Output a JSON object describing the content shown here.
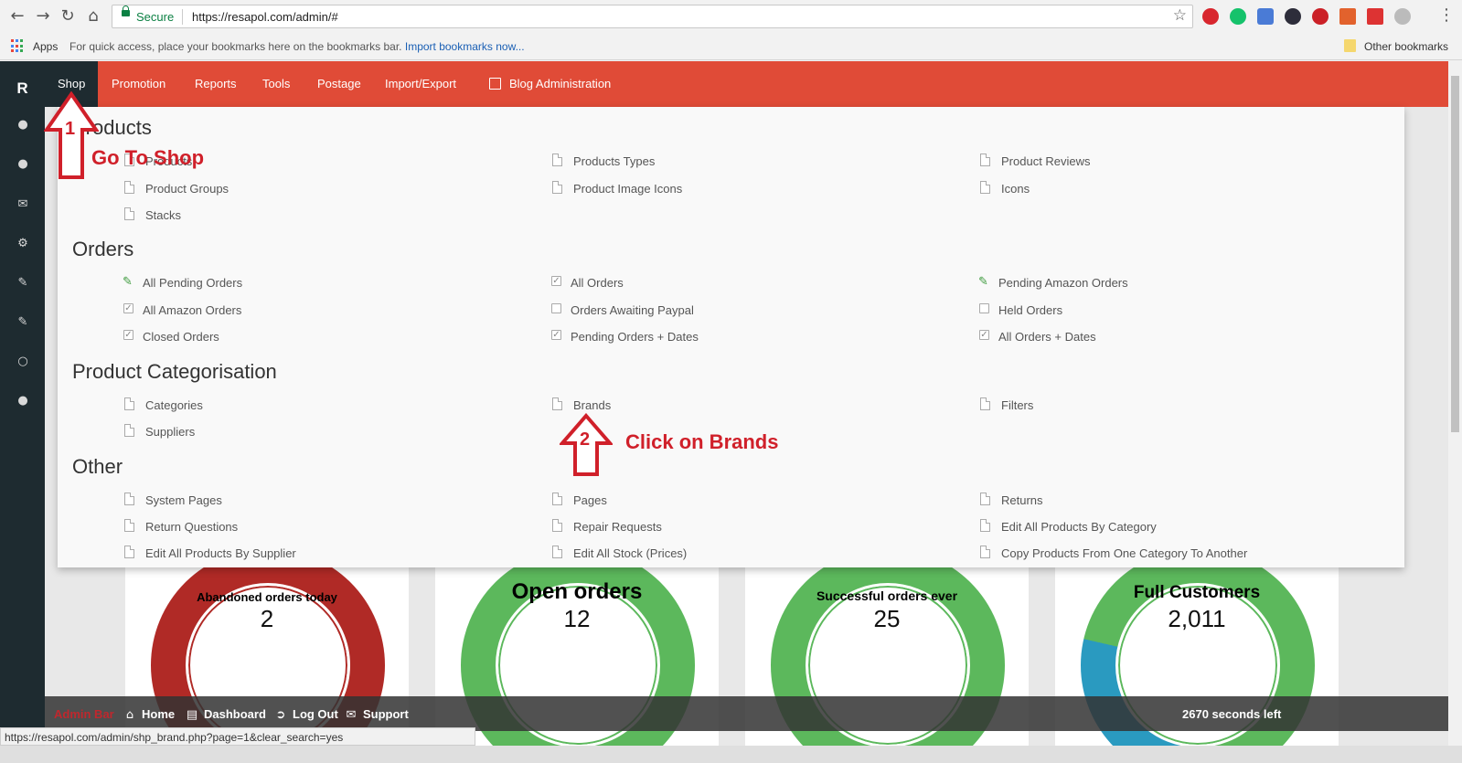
{
  "browser": {
    "secure_label": "Secure",
    "url": "https://resapol.com/admin/#",
    "bookmarks": {
      "apps_label": "Apps",
      "hint_text": "For quick access, place your bookmarks here on the bookmarks bar.",
      "import_link": "Import bookmarks now...",
      "other_label": "Other bookmarks"
    },
    "status_url": "https://resapol.com/admin/shp_brand.php?page=1&clear_search=yes"
  },
  "rail": {
    "logo": "R",
    "icons": [
      "user-icon",
      "user-icon",
      "envelope-icon",
      "gears-icon",
      "edit-icon",
      "edit-icon",
      "circle-icon",
      "user-icon"
    ]
  },
  "topnav": {
    "items": [
      "Shop",
      "Promotion",
      "Reports",
      "Tools",
      "Postage",
      "Import/Export",
      "Blog Administration"
    ],
    "active": "Shop"
  },
  "menu": {
    "products_title": "Products",
    "products": [
      "Products",
      "Products Types",
      "Product Reviews",
      "Product Groups",
      "Product Image Icons",
      "Icons",
      "Stacks"
    ],
    "orders_title": "Orders",
    "orders": [
      "All Pending Orders",
      "All Orders",
      "Pending Amazon Orders",
      "All Amazon Orders",
      "Orders Awaiting Paypal",
      "Held Orders",
      "Closed Orders",
      "Pending Orders + Dates",
      "All Orders + Dates"
    ],
    "categorisation_title": "Product Categorisation",
    "categorisation": [
      "Categories",
      "Brands",
      "Filters",
      "Suppliers"
    ],
    "other_title": "Other",
    "other": [
      "System Pages",
      "Pages",
      "Returns",
      "Return Questions",
      "Repair Requests",
      "Edit All Products By Category",
      "Edit All Products By Supplier",
      "Edit All Stock (Prices)",
      "Copy Products From One Category To Another"
    ]
  },
  "annotations": {
    "step1_num": "1",
    "step1_text": "Go To Shop",
    "step2_num": "2",
    "step2_text": "Click on Brands",
    "color": "#d0202a"
  },
  "stats": [
    {
      "title": "Abandoned orders today",
      "value": "2",
      "color": "#b02a26"
    },
    {
      "title": "Open orders",
      "value": "12",
      "color": "#5cb85c"
    },
    {
      "title": "Successful orders ever",
      "value": "25",
      "color": "#5cb85c"
    },
    {
      "title": "Full Customers",
      "value": "2,011",
      "color": "#5cb85c",
      "secondary_color": "#2a9ac0"
    }
  ],
  "admin_bar": {
    "title": "Admin Bar",
    "home": "Home",
    "dashboard": "Dashboard",
    "logout": "Log Out",
    "support": "Support",
    "timer": "2670 seconds left"
  },
  "colors": {
    "nav_red": "#e04b37",
    "rail_dark": "#1e2b30"
  }
}
